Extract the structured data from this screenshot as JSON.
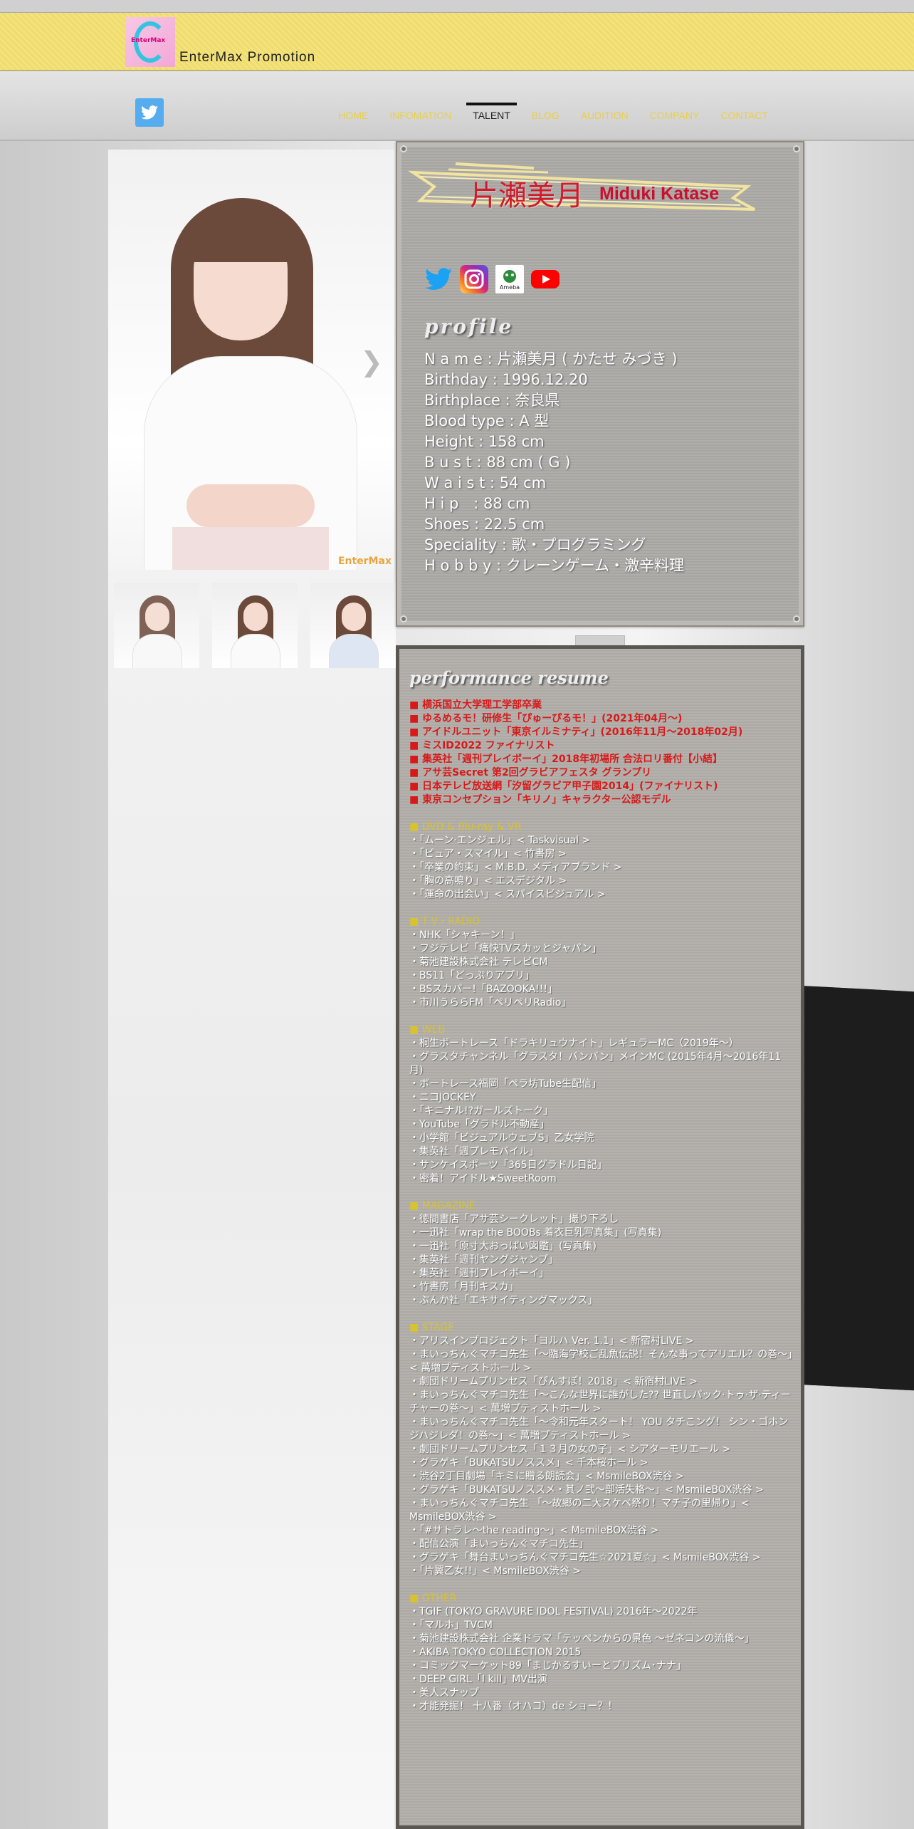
{
  "header": {
    "logo_text": "EnterMax",
    "brand": "EnterMax Promotion"
  },
  "nav": {
    "items": [
      {
        "label": "HOME",
        "active": false
      },
      {
        "label": "INFOMATION",
        "active": false
      },
      {
        "label": "TALENT",
        "active": true
      },
      {
        "label": "BLOG",
        "active": false
      },
      {
        "label": "AUDITION",
        "active": false
      },
      {
        "label": "COMPANY",
        "active": false
      },
      {
        "label": "CONTACT",
        "active": false
      }
    ]
  },
  "gallery": {
    "watermark": "EnterMax"
  },
  "profile": {
    "name_jp": "片瀬美月",
    "name_en": "Miduki Katase",
    "heading": "profile",
    "socials": [
      {
        "name": "twitter-icon"
      },
      {
        "name": "instagram-icon"
      },
      {
        "name": "ameba-icon",
        "label": "Ameba"
      },
      {
        "name": "youtube-icon"
      }
    ],
    "lines": [
      "N a m e : 片瀬美月 ( かたせ みづき )",
      "Birthday : 1996.12.20",
      "Birthplace : 奈良県",
      "Blood type : A 型",
      "Height : 158 cm",
      "B u s t : 88 cm ( G )",
      "W a i s t : 54 cm",
      "H i p　: 88 cm",
      "Shoes : 22.5 cm",
      "Speciality : 歌・プログラミング",
      "H o b b y : クレーンゲーム・激辛料理"
    ]
  },
  "resume": {
    "heading": "performance resume",
    "awards": [
      "■ 横浜国立大学理工学部卒業",
      "■ ゆるめるモ！研修生「ぴゅーぴるモ！」(2021年04月～)",
      "■ アイドルユニット「東京イルミナティ」(2016年11月～2018年02月)",
      "■ ミスID2022 ファイナリスト",
      "■ 集英社「週刊プレイボーイ」2018年初場所 合法ロリ番付【小結】",
      "■ アサ芸Secret 第2回グラビアフェスタ グランプリ",
      "■ 日本テレビ放送網「汐留グラビア甲子園2014」(ファイナリスト)",
      "■ 東京コンセプション「キリノ」キャラクター公認モデル"
    ],
    "sections": [
      {
        "title": "■ DVD & Blu-ray & VR",
        "items": [
          "・「ムーン·エンジェル」< Taskvisual >",
          "・「ピュア・スマイル」< 竹書房 >",
          "・「卒業の約束」< M.B.D. メディアブランド >",
          "・「胸の高鳴り」< エスデジタル >",
          "・「運命の出会い」< スパイスビジュアル >"
        ]
      },
      {
        "title": "■ T V・RADIO",
        "items": [
          "・NHK「シャキーン！」",
          "・フジテレビ「痛快TVスカッとジャパン」",
          "・菊池建設株式会社 テレビCM",
          "・BS11「どっぷりアプリ」",
          "・BSスカパー!「BAZOOKA!!!」",
          "・市川うららFM「ペリペリRadio」"
        ]
      },
      {
        "title": "■ WEB",
        "items": [
          "・桐生ボートレース「ドラキリュウナイト」レギュラーMC（2019年～）",
          "・グラスタチャンネル「グラスタ！バンバン」メインMC (2015年4月～2016年11月)",
          "・ボートレース福岡「ペラ坊Tube生配信」",
          "・ニコJOCKEY",
          "・「キニナル!?ガールズトーク」",
          "・YouTube「グラドル不動産」",
          "・小学館「ビジュアルウェブS」乙女学院",
          "・集英社「週プレモバイル」",
          "・サンケイスポーツ「365日グラドル日記」",
          "・密着！アイドル★SweetRoom"
        ]
      },
      {
        "title": "■ MAGAZINE",
        "items": [
          "・徳間書店「アサ芸シークレット」撮り下ろし",
          "・一迅社「wrap the BOOBs 着衣巨乳写真集」(写真集)",
          "・一迅社「原寸大おっぱい図鑑」(写真集)",
          "・集英社「週刊ヤングジャンプ」",
          "・集英社「週刊プレイボーイ」",
          "・竹書房「月刊キスカ」",
          "・ぶんか社「エキサイティングマックス」"
        ]
      },
      {
        "title": "■ STAGE",
        "items": [
          "・アリスインプロジェクト「ヨルハ Ver. 1.1」< 新宿村LIVE >",
          "・まいっちんぐマチコ先生「～臨海学校ご乱魚伝説！そんな事ってアリエル？の巻～」< 萬増プティストホール >",
          "・劇団ドリームプリンセス「ぴんすぽ！2018」< 新宿村LIVE >",
          "・まいっちんぐマチコ先生「～こんな世界に誰がした?? 世直しパック·トゥ·ザ·ティーチャーの巻～」< 萬増プティストホール >",
          "・まいっちんぐマチコ先生「～令和元年スタート！ YOU タチこング！ シン・ゴホンジハジレダ！の巻～」< 萬増プティストホール >",
          "・劇団ドリームプリンセス「１３月の女の子」< シアターモリエール >",
          "・グラゲキ「BUKATSUノススメ」< 千本桜ホール >",
          "・渋谷2丁目劇場「キミに贈る朗読会」< MsmileBOX渋谷 >",
          "・グラゲキ「BUKATSUノススメ・其ノ弐～部活失格～」< MsmileBOX渋谷 >",
          "・まいっちんぐマチコ先生 「～故郷の二大スケベ祭り！マチ子の里帰り」< MsmileBOX渋谷 >",
          "・「#サトラレ～the reading～」< MsmileBOX渋谷 >",
          "・配信公演「まいっちんぐマチコ先生」",
          "・グラゲキ「舞台まいっちんぐマチコ先生☆2021夏☆」< MsmileBOX渋谷 >",
          "・「片翼乙女!!」< MsmileBOX渋谷 >"
        ]
      },
      {
        "title": "■ OTHER",
        "items": [
          "・TGIF (TOKYO GRAVURE IDOL FESTIVAL) 2016年～2022年",
          "・「マルホ」TVCM",
          "・菊池建設株式会社 企業ドラマ「テッペンからの景色 ～ゼネコンの流儀～」",
          "・AKIBA TOKYO COLLECTION 2015",
          "・コミックマーケット89「まじかるすいーとプリズム･ナナ」",
          "・DEEP GIRL「I kill」MV出演",
          "・美人スナップ",
          "・才能発掘！ 十八番（オハコ）de ショー？！"
        ]
      }
    ]
  },
  "colors": {
    "banner": "#f3e37e",
    "nav_link": "#e8d04a",
    "award_red": "#d61a1a",
    "section_gold": "#d8c22e",
    "twitter": "#55acee"
  }
}
